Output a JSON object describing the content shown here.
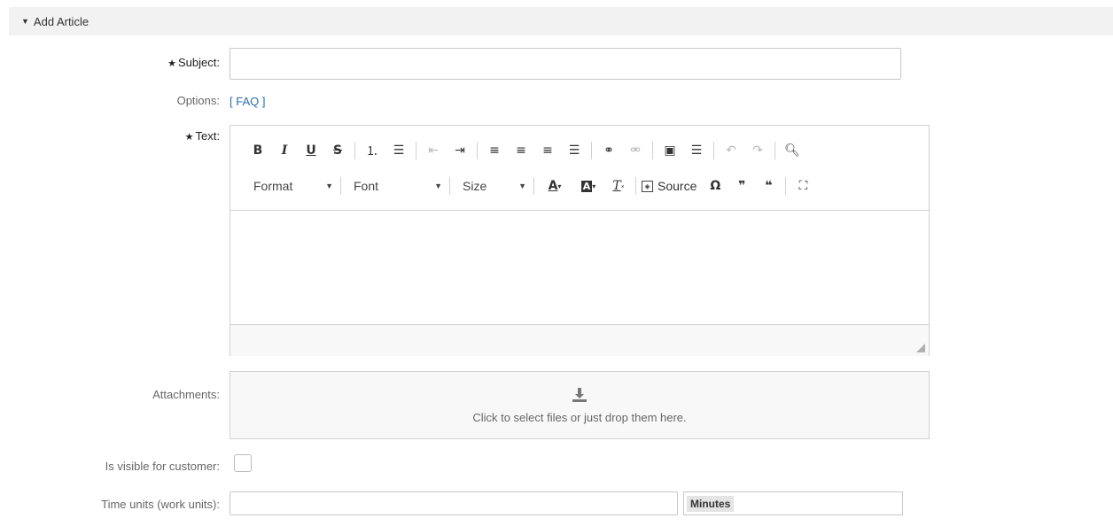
{
  "panel": {
    "title": "Add Article"
  },
  "subject": {
    "label": "Subject:",
    "value": ""
  },
  "options": {
    "label": "Options:",
    "faq_link": "[ FAQ ]"
  },
  "text": {
    "label": "Text:",
    "toolbar": {
      "format_label": "Format",
      "font_label": "Font",
      "size_label": "Size",
      "source_label": "Source"
    },
    "value": ""
  },
  "attachments": {
    "label": "Attachments:",
    "drop_text": "Click to select files or just drop them here."
  },
  "visible_for_customer": {
    "label": "Is visible for customer:",
    "checked": false
  },
  "time_units": {
    "label": "Time units (work units):",
    "value": "",
    "unit": "Minutes"
  },
  "colors": {
    "link": "#2a6fb0",
    "header_bg": "#f2f2f2",
    "border": "#d1d1d1"
  }
}
